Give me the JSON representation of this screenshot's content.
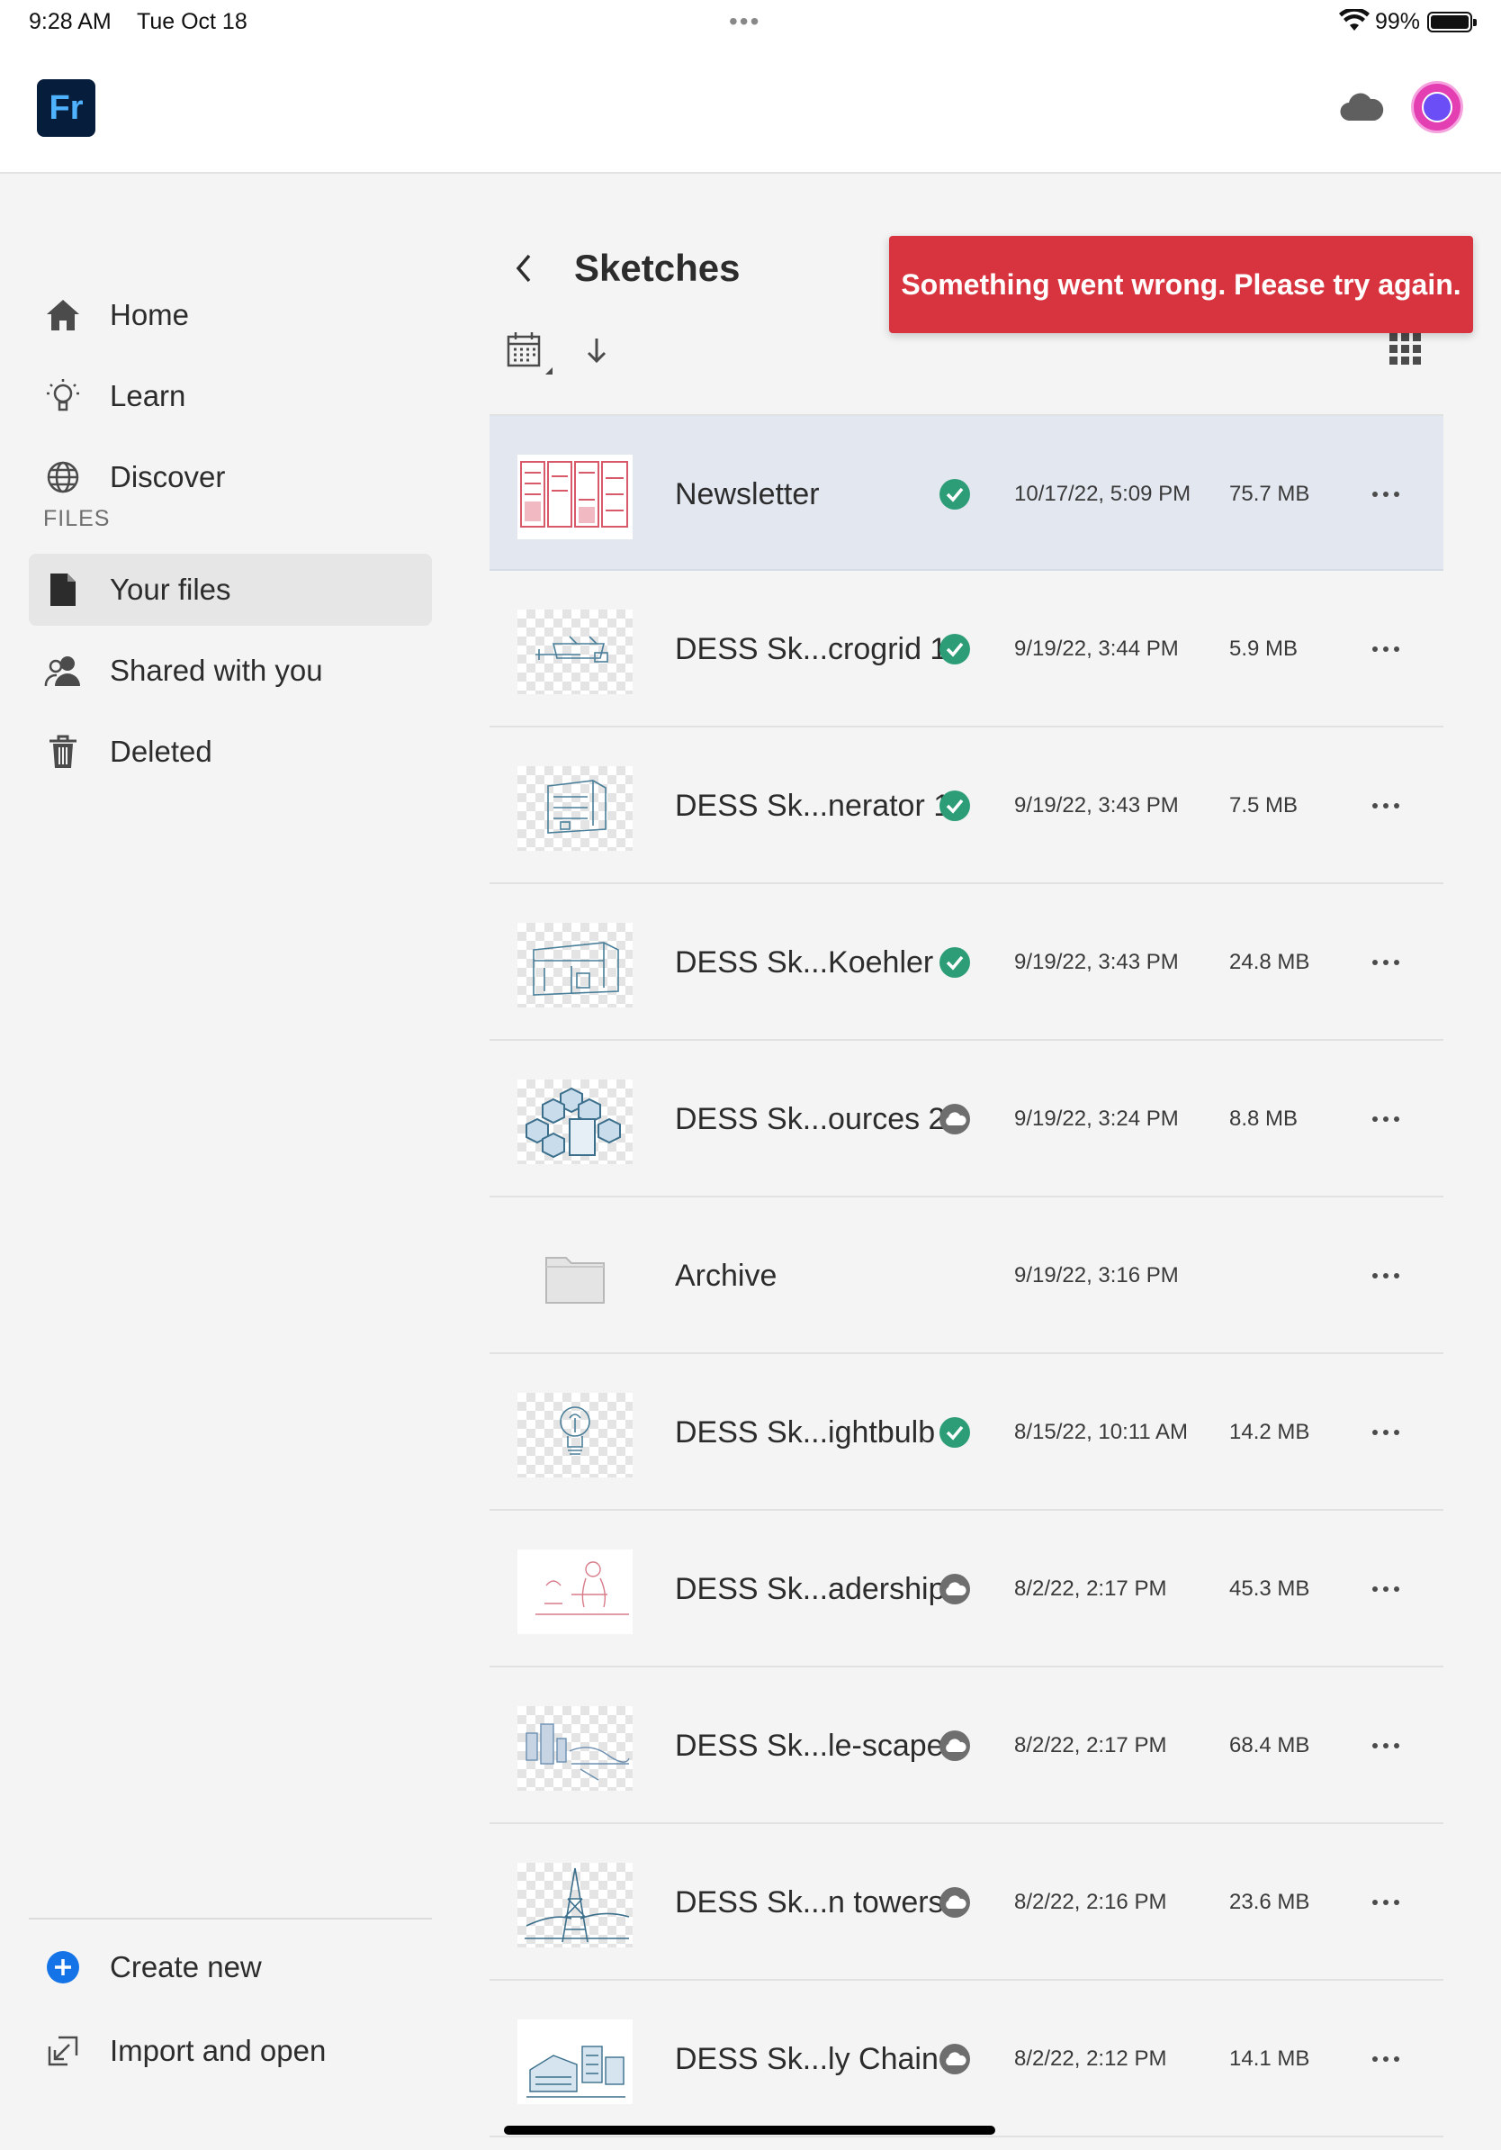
{
  "status_bar": {
    "time": "9:28 AM",
    "date": "Tue Oct 18",
    "multitask": "•••",
    "battery_text": "99%"
  },
  "app": {
    "logo_text": "Fr"
  },
  "toast": {
    "message": "Something went wrong. Please try again."
  },
  "sidebar": {
    "nav": [
      {
        "label": "Home",
        "icon": "home-icon"
      },
      {
        "label": "Learn",
        "icon": "lightbulb-icon"
      },
      {
        "label": "Discover",
        "icon": "globe-icon"
      }
    ],
    "files_heading": "FILES",
    "files": [
      {
        "label": "Your files",
        "icon": "document-icon",
        "active": true
      },
      {
        "label": "Shared with you",
        "icon": "people-icon"
      },
      {
        "label": "Deleted",
        "icon": "trash-icon"
      }
    ],
    "bottom": [
      {
        "label": "Create new",
        "icon": "plus-circle-icon"
      },
      {
        "label": "Import and open",
        "icon": "import-icon"
      }
    ]
  },
  "main": {
    "folder_title": "Sketches",
    "files": [
      {
        "name": "Newsletter",
        "status": "synced",
        "date": "10/17/22, 5:09 PM",
        "size": "75.7 MB",
        "thumb": "newsletter",
        "selected": true
      },
      {
        "name": "DESS Sk...crogrid 1",
        "status": "synced",
        "date": "9/19/22, 3:44 PM",
        "size": "5.9 MB",
        "thumb": "sketch"
      },
      {
        "name": "DESS Sk...nerator 1",
        "status": "synced",
        "date": "9/19/22, 3:43 PM",
        "size": "7.5 MB",
        "thumb": "sketch"
      },
      {
        "name": "DESS Sk...Koehler",
        "status": "synced",
        "date": "9/19/22, 3:43 PM",
        "size": "24.8 MB",
        "thumb": "sketch"
      },
      {
        "name": "DESS Sk...ources 2",
        "status": "cloud",
        "date": "9/19/22, 3:24 PM",
        "size": "8.8 MB",
        "thumb": "hex"
      },
      {
        "name": "Archive",
        "status": "none",
        "date": "9/19/22, 3:16 PM",
        "size": "",
        "thumb": "folder"
      },
      {
        "name": "DESS Sk...ightbulb",
        "status": "synced",
        "date": "8/15/22, 10:11 AM",
        "size": "14.2 MB",
        "thumb": "sketch"
      },
      {
        "name": "DESS Sk...adership",
        "status": "cloud",
        "date": "8/2/22, 2:17 PM",
        "size": "45.3 MB",
        "thumb": "red-sketch"
      },
      {
        "name": "DESS Sk...le-scape",
        "status": "cloud",
        "date": "8/2/22, 2:17 PM",
        "size": "68.4 MB",
        "thumb": "sketch"
      },
      {
        "name": "DESS Sk...n towers",
        "status": "cloud",
        "date": "8/2/22, 2:16 PM",
        "size": "23.6 MB",
        "thumb": "sketch"
      },
      {
        "name": "DESS Sk...ly Chain",
        "status": "cloud",
        "date": "8/2/22, 2:12 PM",
        "size": "14.1 MB",
        "thumb": "sketch"
      }
    ]
  },
  "colors": {
    "accent_blue": "#1473e6",
    "error_red": "#d8343f",
    "synced_green": "#2d9d78",
    "selected_row": "#e2e7f0"
  }
}
